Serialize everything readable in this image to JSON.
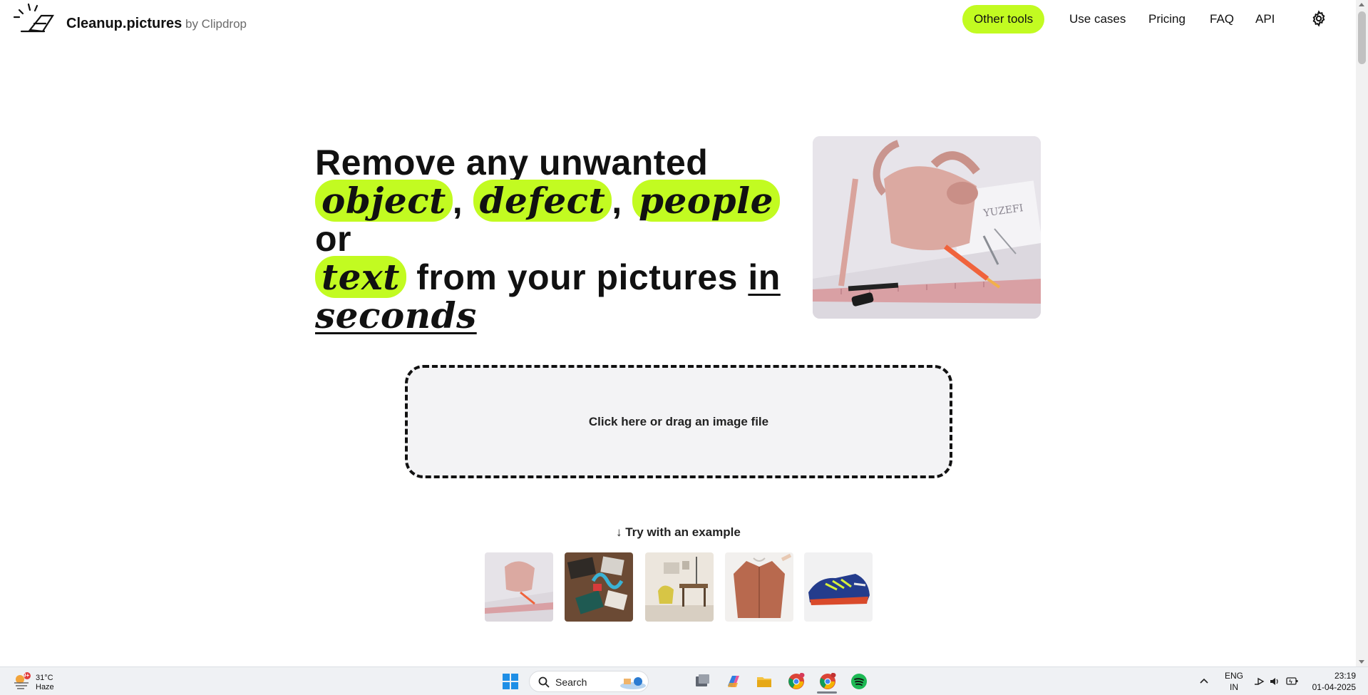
{
  "header": {
    "brand": "Cleanup.pictures",
    "brand_by": "by Clipdrop",
    "nav": {
      "other_tools": "Other tools",
      "use_cases": "Use cases",
      "pricing": "Pricing",
      "faq": "FAQ",
      "api": "API"
    }
  },
  "hero": {
    "line1": "Remove any unwanted",
    "w_object": "object",
    "comma1": ",",
    "w_defect": "defect",
    "comma2": ",",
    "w_people": "people",
    "w_or": "or",
    "w_text": "text",
    "w_from": "from your pictures",
    "w_in": "in",
    "w_seconds": "seconds"
  },
  "dropzone": {
    "label": "Click here or drag an image file"
  },
  "examples": {
    "label": "↓ Try with an example"
  },
  "taskbar": {
    "temp": "31°C",
    "weather": "Haze",
    "badge": "9+",
    "search": "Search",
    "lang1": "ENG",
    "lang2": "IN",
    "time": "23:19",
    "date": "01-04-2025"
  },
  "colors": {
    "accent": "#c2fb21",
    "dropzone_bg": "#f3f3f5"
  }
}
